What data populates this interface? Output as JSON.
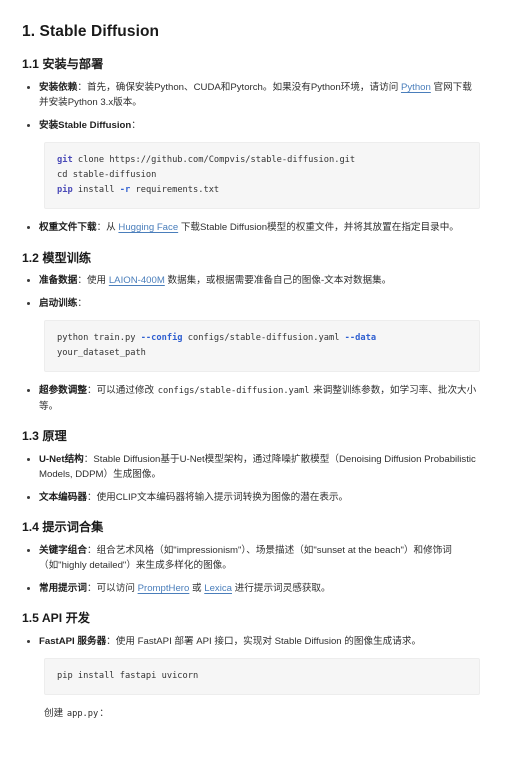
{
  "document": {
    "title": "1. Stable Diffusion",
    "sections": [
      {
        "heading": "1.1 安装与部署",
        "bullets": [
          {
            "term": "安装依赖",
            "sep": "：",
            "parts": [
              {
                "type": "text",
                "value": "首先，确保安装Python、CUDA和Pytorch。如果没有Python环境，请访问 "
              },
              {
                "type": "link",
                "value": "Python"
              },
              {
                "type": "text",
                "value": " 官网下载并安装Python 3.x版本。"
              }
            ]
          },
          {
            "term": "安装Stable Diffusion",
            "sep": "：",
            "parts": []
          }
        ],
        "code": {
          "lines": [
            [
              {
                "t": "kw",
                "v": "git"
              },
              {
                "t": "plain",
                "v": " clone https://github.com/Compvis/stable-diffusion.git"
              }
            ],
            [
              {
                "t": "plain",
                "v": "cd stable-diffusion"
              }
            ],
            [
              {
                "t": "kw",
                "v": "pip"
              },
              {
                "t": "plain",
                "v": " install "
              },
              {
                "t": "flag",
                "v": "-r"
              },
              {
                "t": "plain",
                "v": " requirements.txt"
              }
            ]
          ]
        },
        "after_bullets": [
          {
            "term": "权重文件下载",
            "sep": "：",
            "parts": [
              {
                "type": "text",
                "value": "从 "
              },
              {
                "type": "link",
                "value": "Hugging Face"
              },
              {
                "type": "text",
                "value": " 下载Stable Diffusion模型的权重文件，并将其放置在指定目录中。"
              }
            ]
          }
        ]
      },
      {
        "heading": "1.2 模型训练",
        "bullets": [
          {
            "term": "准备数据",
            "sep": "：",
            "parts": [
              {
                "type": "text",
                "value": "使用 "
              },
              {
                "type": "link",
                "value": "LAION-400M"
              },
              {
                "type": "text",
                "value": " 数据集，或根据需要准备自己的图像-文本对数据集。"
              }
            ]
          },
          {
            "term": "启动训练",
            "sep": "：",
            "parts": []
          }
        ],
        "code": {
          "lines": [
            [
              {
                "t": "plain",
                "v": "python train.py "
              },
              {
                "t": "flag",
                "v": "--config"
              },
              {
                "t": "plain",
                "v": " configs/stable-diffusion.yaml "
              },
              {
                "t": "flag",
                "v": "--data"
              },
              {
                "t": "plain",
                "v": " your_dataset_path"
              }
            ]
          ]
        },
        "after_bullets": [
          {
            "term": "超参数调整",
            "sep": "：",
            "parts": [
              {
                "type": "text",
                "value": "可以通过修改 "
              },
              {
                "type": "code",
                "value": "configs/stable-diffusion.yaml"
              },
              {
                "type": "text",
                "value": " 来调整训练参数，如学习率、批次大小等。"
              }
            ]
          }
        ]
      },
      {
        "heading": "1.3 原理",
        "bullets": [
          {
            "term": "U-Net结构",
            "sep": "：",
            "parts": [
              {
                "type": "text",
                "value": "Stable Diffusion基于U-Net模型架构，通过降噪扩散模型（Denoising Diffusion Probabilistic Models, DDPM）生成图像。"
              }
            ]
          },
          {
            "term": "文本编码器",
            "sep": "：",
            "parts": [
              {
                "type": "text",
                "value": "使用CLIP文本编码器将输入提示词转换为图像的潜在表示。"
              }
            ]
          }
        ]
      },
      {
        "heading": "1.4 提示词合集",
        "bullets": [
          {
            "term": "关键字组合",
            "sep": "：",
            "parts": [
              {
                "type": "text",
                "value": "组合艺术风格（如\"impressionism\"）、场景描述（如\"sunset at the beach\"）和修饰词（如\"highly detailed\"）来生成多样化的图像。"
              }
            ]
          },
          {
            "term": "常用提示词",
            "sep": "：",
            "parts": [
              {
                "type": "text",
                "value": "可以访问 "
              },
              {
                "type": "link",
                "value": "PromptHero"
              },
              {
                "type": "text",
                "value": " 或 "
              },
              {
                "type": "link",
                "value": "Lexica"
              },
              {
                "type": "text",
                "value": " 进行提示词灵感获取。"
              }
            ]
          }
        ]
      },
      {
        "heading": "1.5 API 开发",
        "bullets": [
          {
            "term": "FastAPI 服务器",
            "sep": "：",
            "parts": [
              {
                "type": "text",
                "value": "使用 FastAPI 部署 API 接口，实现对 Stable Diffusion 的图像生成请求。"
              }
            ]
          }
        ],
        "code": {
          "lines": [
            [
              {
                "t": "plain",
                "v": "pip install fastapi uvicorn"
              }
            ]
          ]
        },
        "trailing": [
          {
            "type": "text",
            "value": "创建 "
          },
          {
            "type": "code",
            "value": "app.py"
          },
          {
            "type": "text",
            "value": "："
          }
        ]
      }
    ]
  }
}
